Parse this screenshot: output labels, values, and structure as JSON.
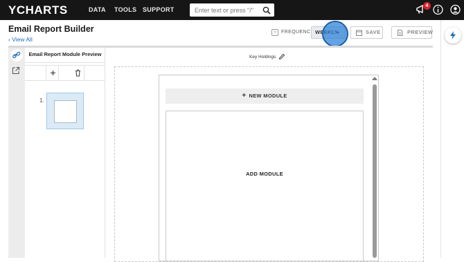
{
  "nav": {
    "logo": "YCHARTS",
    "links": [
      "DATA",
      "TOOLS",
      "SUPPORT"
    ],
    "search_placeholder": "Enter text or press \"/\"",
    "notification_count": "4"
  },
  "header": {
    "title": "Email Report Builder",
    "back_link": "View All",
    "frequency_label": "FREQUENCY:",
    "frequency_value": "WEEKLY",
    "save_label": "SAVE",
    "preview_label": "PREVIEW"
  },
  "left_panel": {
    "header": "Email Report Module Preview",
    "item_number": "1."
  },
  "preview": {
    "title": "Key Holdings",
    "new_module_label": "NEW MODULE",
    "add_module_label": "ADD MODULE"
  },
  "colors": {
    "nav_bg": "#161616",
    "link": "#1f6fb8",
    "badge": "#d9232d",
    "highlight": "#2880d6"
  }
}
